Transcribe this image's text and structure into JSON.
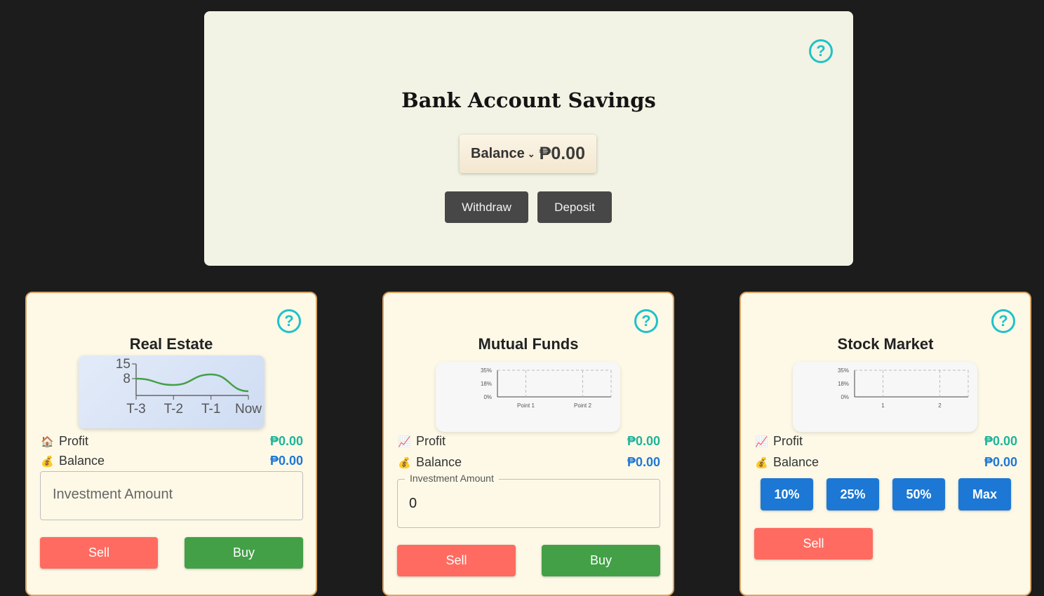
{
  "bank": {
    "title": "Bank Account Savings",
    "balance_label": "Balance",
    "balance_value": "₱0.00",
    "withdraw_label": "Withdraw",
    "deposit_label": "Deposit",
    "help": "?"
  },
  "real_estate": {
    "title": "Real Estate",
    "help": "?",
    "profit_label": "Profit",
    "profit_value": "₱0.00",
    "profit_icon": "house-icon",
    "balance_label": "Balance",
    "balance_value": "₱0.00",
    "balance_icon": "money-bag-icon",
    "input_placeholder": "Investment Amount",
    "sell_label": "Sell",
    "buy_label": "Buy",
    "chart_data": {
      "type": "line",
      "categories": [
        "T-3",
        "T-2",
        "T-1",
        "Now"
      ],
      "y_ticks": [
        "15",
        "8"
      ],
      "ylim": [
        0,
        15
      ],
      "values": [
        8,
        5,
        10,
        2
      ]
    }
  },
  "mutual_funds": {
    "title": "Mutual Funds",
    "help": "?",
    "profit_label": "Profit",
    "profit_value": "₱0.00",
    "profit_icon": "chart-increasing-icon",
    "balance_label": "Balance",
    "balance_value": "₱0.00",
    "balance_icon": "money-bag-icon",
    "input_label": "Investment Amount",
    "input_value": "0",
    "sell_label": "Sell",
    "buy_label": "Buy",
    "chart_data": {
      "type": "line",
      "categories": [
        "Point 1",
        "Point 2"
      ],
      "y_ticks": [
        "35%",
        "18%",
        "0%"
      ],
      "values": []
    }
  },
  "stock_market": {
    "title": "Stock Market",
    "help": "?",
    "profit_label": "Profit",
    "profit_value": "₱0.00",
    "profit_icon": "chart-increasing-icon",
    "balance_label": "Balance",
    "balance_value": "₱0.00",
    "balance_icon": "money-bag-icon",
    "pct_buttons": [
      "10%",
      "25%",
      "50%",
      "Max"
    ],
    "sell_label": "Sell",
    "chart_data": {
      "type": "line",
      "categories": [
        "1",
        "2"
      ],
      "y_ticks": [
        "35%",
        "18%",
        "0%"
      ],
      "values": []
    }
  },
  "colors": {
    "accent": "#1fc2c8",
    "profit": "#1fb39a",
    "balance": "#1f77d4",
    "sell": "#ff6b60",
    "buy": "#43a047",
    "pct": "#1c78d4"
  }
}
